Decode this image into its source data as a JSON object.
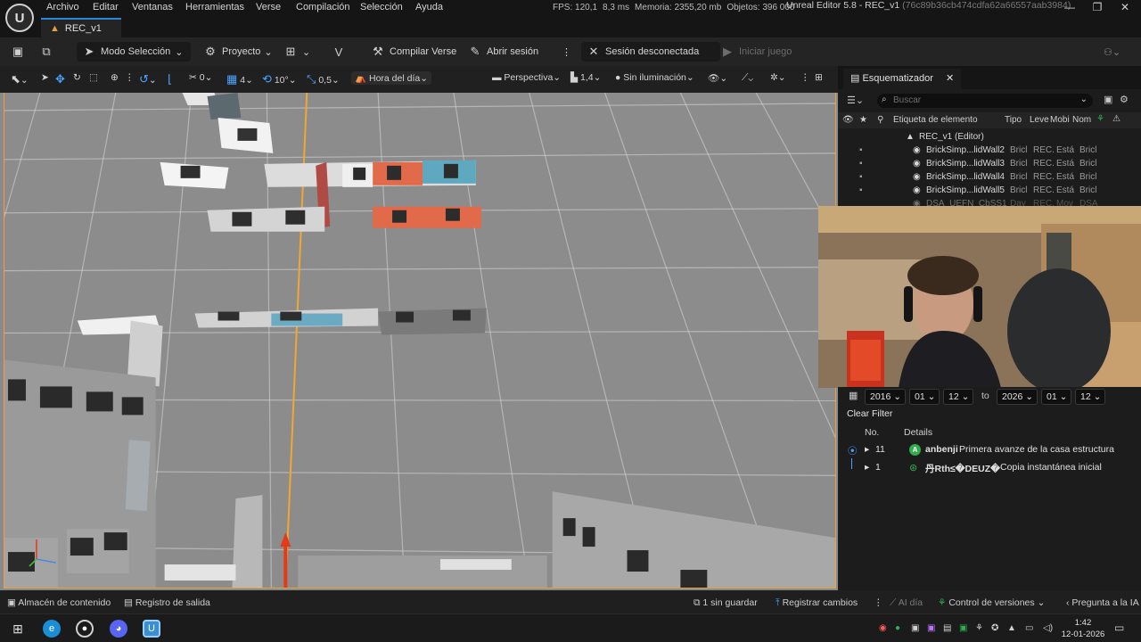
{
  "menubar": {
    "items": [
      "Archivo",
      "Editar",
      "Ventanas",
      "Herramientas",
      "Verse",
      "Compilación",
      "Selección",
      "Ayuda"
    ],
    "stats": {
      "fps": "FPS: 120,1",
      "ms": "8,3 ms",
      "memory": "Memoria: 2355,20 mb",
      "objects": "Objetos: 396 000"
    },
    "window_title": "Unreal Editor 5.8 - REC_v1",
    "window_hash": "(76c89b36cb474cdfa62a66557aab3984)"
  },
  "tabs": {
    "map_tab": "REC_v1"
  },
  "toolbar": {
    "mode_select": "Modo Selección",
    "project": "Proyecto",
    "compile": "Compilar Verse",
    "open_session": "Abrir sesión",
    "session_status": "Sesión desconectada",
    "start_game": "Iniciar juego"
  },
  "viewport_toolbar": {
    "rotate_snap_count": "0",
    "grid_count": "4",
    "angle_snap": "10°",
    "scale_snap": "0,5",
    "time_of_day": "Hora del día",
    "perspective": "Perspectiva",
    "speed": "1,4",
    "lighting": "Sin iluminación"
  },
  "outliner": {
    "tab_title": "Esquematizador",
    "search_placeholder": "Buscar",
    "columns": {
      "label": "Etiqueta de elemento",
      "type": "Tipo",
      "level": "Leve",
      "mobility": "Mobi",
      "name": "Nom"
    },
    "root": "REC_v1 (Editor)",
    "rows": [
      {
        "name": "BrickSimp...lidWall2",
        "type": "Bricl",
        "level": "REC.",
        "mobility": "Está",
        "extra": "Bricl"
      },
      {
        "name": "BrickSimp...lidWall3",
        "type": "Bricl",
        "level": "REC.",
        "mobility": "Está",
        "extra": "Bricl"
      },
      {
        "name": "BrickSimp...lidWall4",
        "type": "Bricl",
        "level": "REC.",
        "mobility": "Está",
        "extra": "Bricl"
      },
      {
        "name": "BrickSimp...lidWall5",
        "type": "Bricl",
        "level": "REC.",
        "mobility": "Está",
        "extra": "Bricl"
      },
      {
        "name": "DSA_UEFN_CbSS1",
        "type": "Day",
        "level": "REC.",
        "mobility": "Mov",
        "extra": "DSA"
      }
    ]
  },
  "history": {
    "from": {
      "year": "2016",
      "month": "01",
      "day": "12"
    },
    "to_label": "to",
    "to": {
      "year": "2026",
      "month": "01",
      "day": "12"
    },
    "clear_filter": "Clear Filter",
    "col_no": "No.",
    "col_details": "Details",
    "entries": [
      {
        "no": "11",
        "avatar": "A",
        "avatar_color": "#2fae4e",
        "user": "anbenji",
        "desc": "Primera avanze de la casa  estructura"
      },
      {
        "no": "1",
        "avatar": "",
        "avatar_color": "#2fae4e",
        "user": "丹Rth≤�DEUZ�",
        "desc": "Copia instantánea inicial"
      }
    ]
  },
  "statusbar": {
    "content": "Almacén de contenido",
    "output_log": "Registro de salida",
    "unsaved": "1 sin guardar",
    "register_changes": "Registrar cambios",
    "ai_day": "AI día",
    "version_control": "Control de versiones",
    "ask_ai": "Pregunta a la IA"
  },
  "taskbar": {
    "time": "1:42",
    "date": "12-01-2026"
  },
  "colors": {
    "accent_blue": "#2a88d6",
    "selection_orange": "#e8a23b",
    "green_avatar": "#2fae4e"
  }
}
